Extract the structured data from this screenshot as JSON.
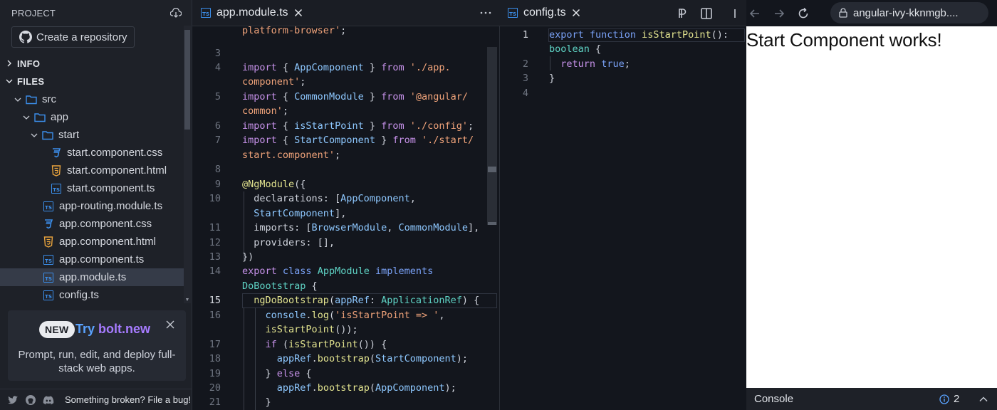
{
  "sidebar": {
    "title": "PROJECT",
    "create_repo": "Create a repository",
    "sections": {
      "info": "INFO",
      "files": "FILES"
    },
    "tree": [
      {
        "label": "src",
        "type": "folder"
      },
      {
        "label": "app",
        "type": "folder"
      },
      {
        "label": "start",
        "type": "folder"
      },
      {
        "label": "start.component.css",
        "type": "css"
      },
      {
        "label": "start.component.html",
        "type": "html"
      },
      {
        "label": "start.component.ts",
        "type": "ts"
      },
      {
        "label": "app-routing.module.ts",
        "type": "ts"
      },
      {
        "label": "app.component.css",
        "type": "css"
      },
      {
        "label": "app.component.html",
        "type": "html"
      },
      {
        "label": "app.component.ts",
        "type": "ts"
      },
      {
        "label": "app.module.ts",
        "type": "ts",
        "selected": true
      },
      {
        "label": "config.ts",
        "type": "ts"
      }
    ],
    "promo": {
      "badge": "NEW",
      "try": "Try ",
      "brand": "bolt.new",
      "desc_line1": "Prompt, run, edit, and deploy full-",
      "desc_line2": "stack web apps."
    },
    "footer": "Something broken? File a bug!"
  },
  "editor1": {
    "tab": "app.module.ts",
    "line_numbers": [
      "3",
      "4",
      "5",
      "6",
      "7",
      "8",
      "9",
      "10",
      "11",
      "12",
      "13",
      "14",
      "15",
      "16",
      "17",
      "18",
      "19",
      "20",
      "21"
    ],
    "active_line": "15"
  },
  "editor2": {
    "tab": "config.ts",
    "line_numbers": [
      "1",
      "2",
      "3",
      "4"
    ],
    "active_line": "1"
  },
  "browser": {
    "url": "angular-ivy-kknmgb....",
    "heading": "Start Component works!",
    "console_label": "Console",
    "console_count": "2"
  },
  "colors": {
    "ts_blue": "#3b8eea",
    "html_orange": "#e8a33d",
    "keyword_purple": "#c792ea",
    "string_orange": "#f0a37a",
    "brand_blue": "#5aa3ff",
    "brand_purple": "#a67bff"
  }
}
